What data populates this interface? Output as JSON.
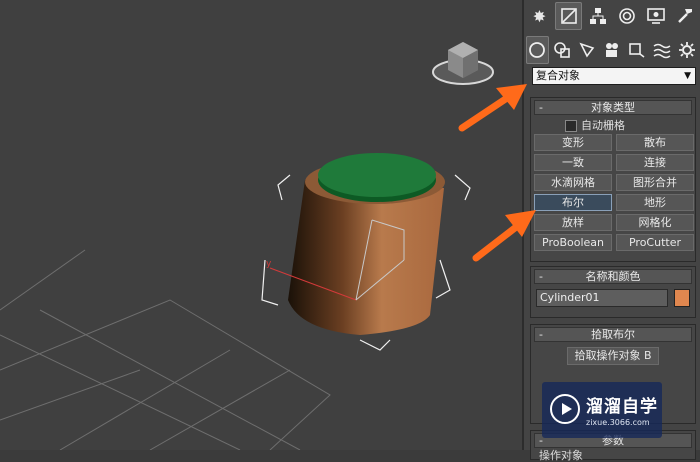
{
  "tabs": {
    "top": [
      "sun-icon",
      "modify-icon",
      "hierarchy-icon",
      "motion-icon",
      "display-icon",
      "utilities-icon"
    ],
    "create": [
      "sphere-icon",
      "shapes-icon",
      "light-icon",
      "camera-icon",
      "helper-icon",
      "spacewarp-icon",
      "systems-icon"
    ]
  },
  "dropdown": {
    "value": "复合对象"
  },
  "object_type": {
    "title": "对象类型",
    "autogrid_label": "自动栅格",
    "buttons": [
      "变形",
      "散布",
      "一致",
      "连接",
      "水滴网格",
      "图形合并",
      "布尔",
      "地形",
      "放样",
      "网格化",
      "ProBoolean",
      "ProCutter"
    ],
    "active": "布尔"
  },
  "name_color": {
    "title": "名称和颜色",
    "name": "Cylinder01",
    "color": "#e0874f"
  },
  "pick_boolean": {
    "title": "拾取布尔",
    "button": "拾取操作对象 B"
  },
  "params": {
    "title": "参数",
    "operands_label": "操作对象"
  },
  "watermark": {
    "text": "溜溜自学",
    "url": "zixue.3066.com"
  },
  "colors": {
    "accent": "#ff6a1a",
    "cylinder": "#b8744a",
    "cap": "#1f7a3a"
  }
}
